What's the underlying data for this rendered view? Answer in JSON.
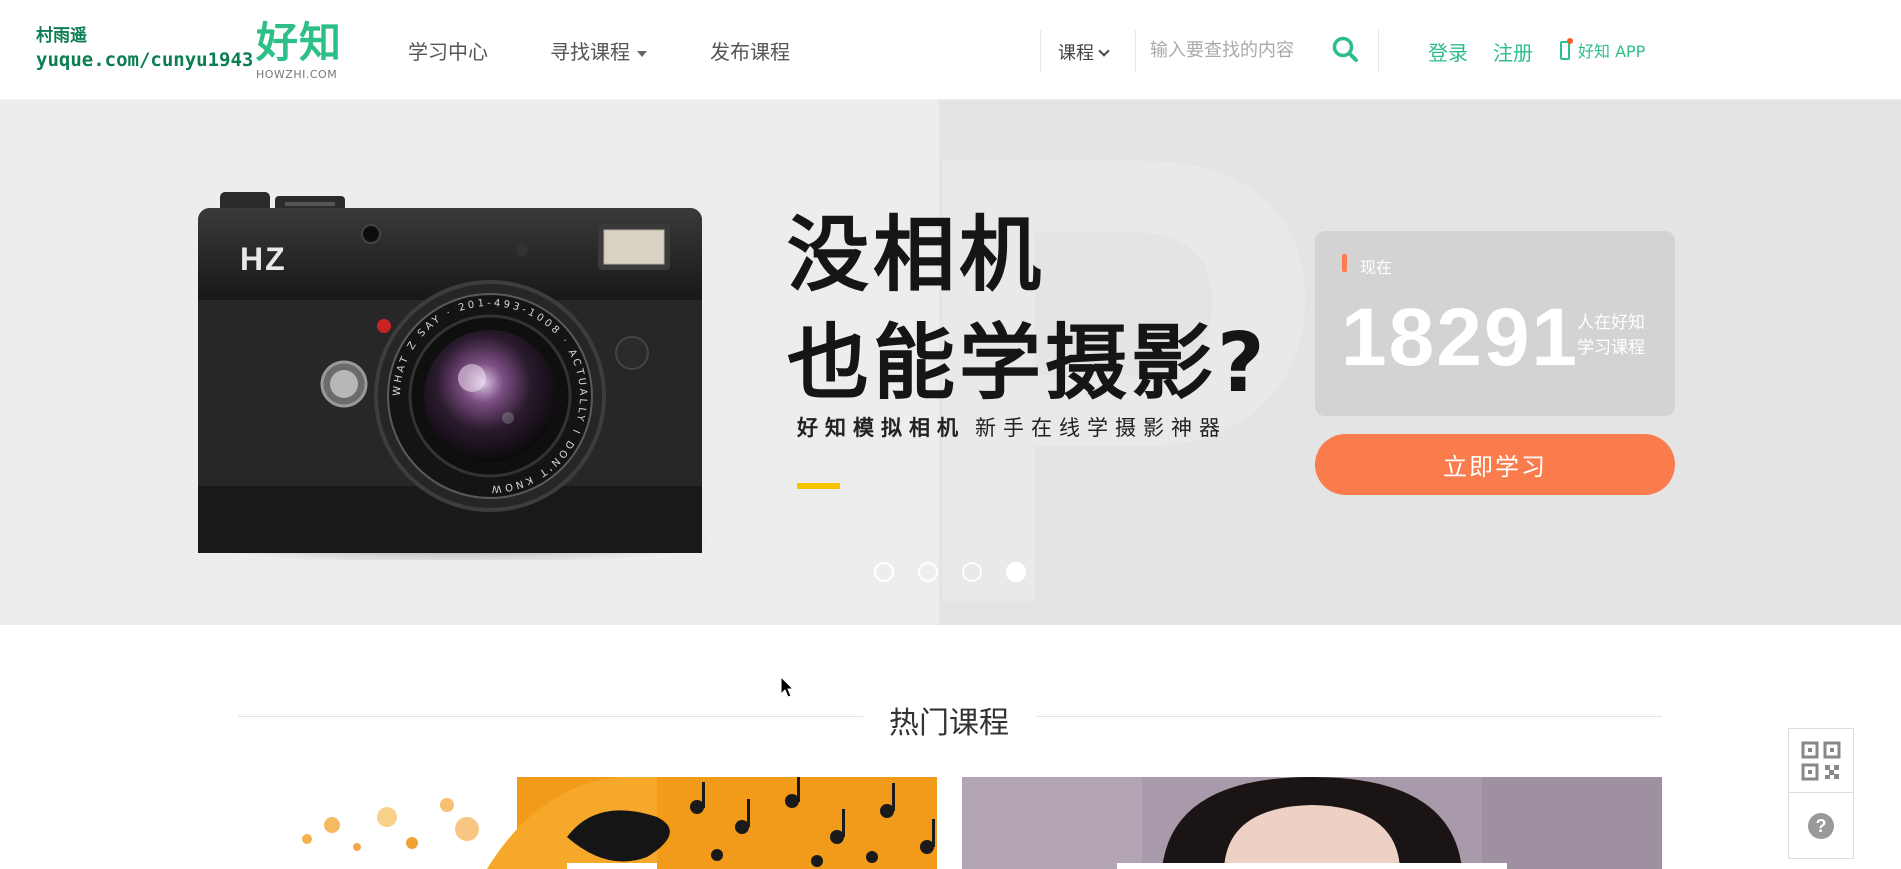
{
  "watermark": {
    "line1": "村雨遥",
    "line2": "yuque.com/cunyu1943"
  },
  "logo": {
    "cn": "好知",
    "en": "HOWZHI.COM"
  },
  "nav": {
    "items": [
      "学习中心",
      "寻找课程",
      "发布课程"
    ]
  },
  "search": {
    "category": "课程",
    "placeholder": "输入要查找的内容"
  },
  "auth": {
    "login": "登录",
    "register": "注册",
    "app": "好知 APP"
  },
  "banner": {
    "headline1": "没相机",
    "headline2": "也能学摄影?",
    "sub_bold": "好知模拟相机",
    "sub_rest": "新手在线学摄影神器",
    "camera_brand": "HZ",
    "lens_text": "WHAT Z SAY · 201-493-1008 · ACTUALLY I DON'T KNOW",
    "slides": 4,
    "active_slide": 4,
    "stat": {
      "label": "现在",
      "number": "18291",
      "desc": "人在好知学习课程"
    },
    "cta": "立即学习"
  },
  "section": {
    "title": "热门课程"
  },
  "colors": {
    "brand_green": "#2cbf88",
    "accent_orange": "#fa7b4c",
    "highlight_yellow": "#f8c300"
  },
  "icons": [
    "search-icon",
    "chevron-down-icon",
    "phone-icon",
    "qr-code-icon",
    "help-icon",
    "cursor-icon"
  ]
}
